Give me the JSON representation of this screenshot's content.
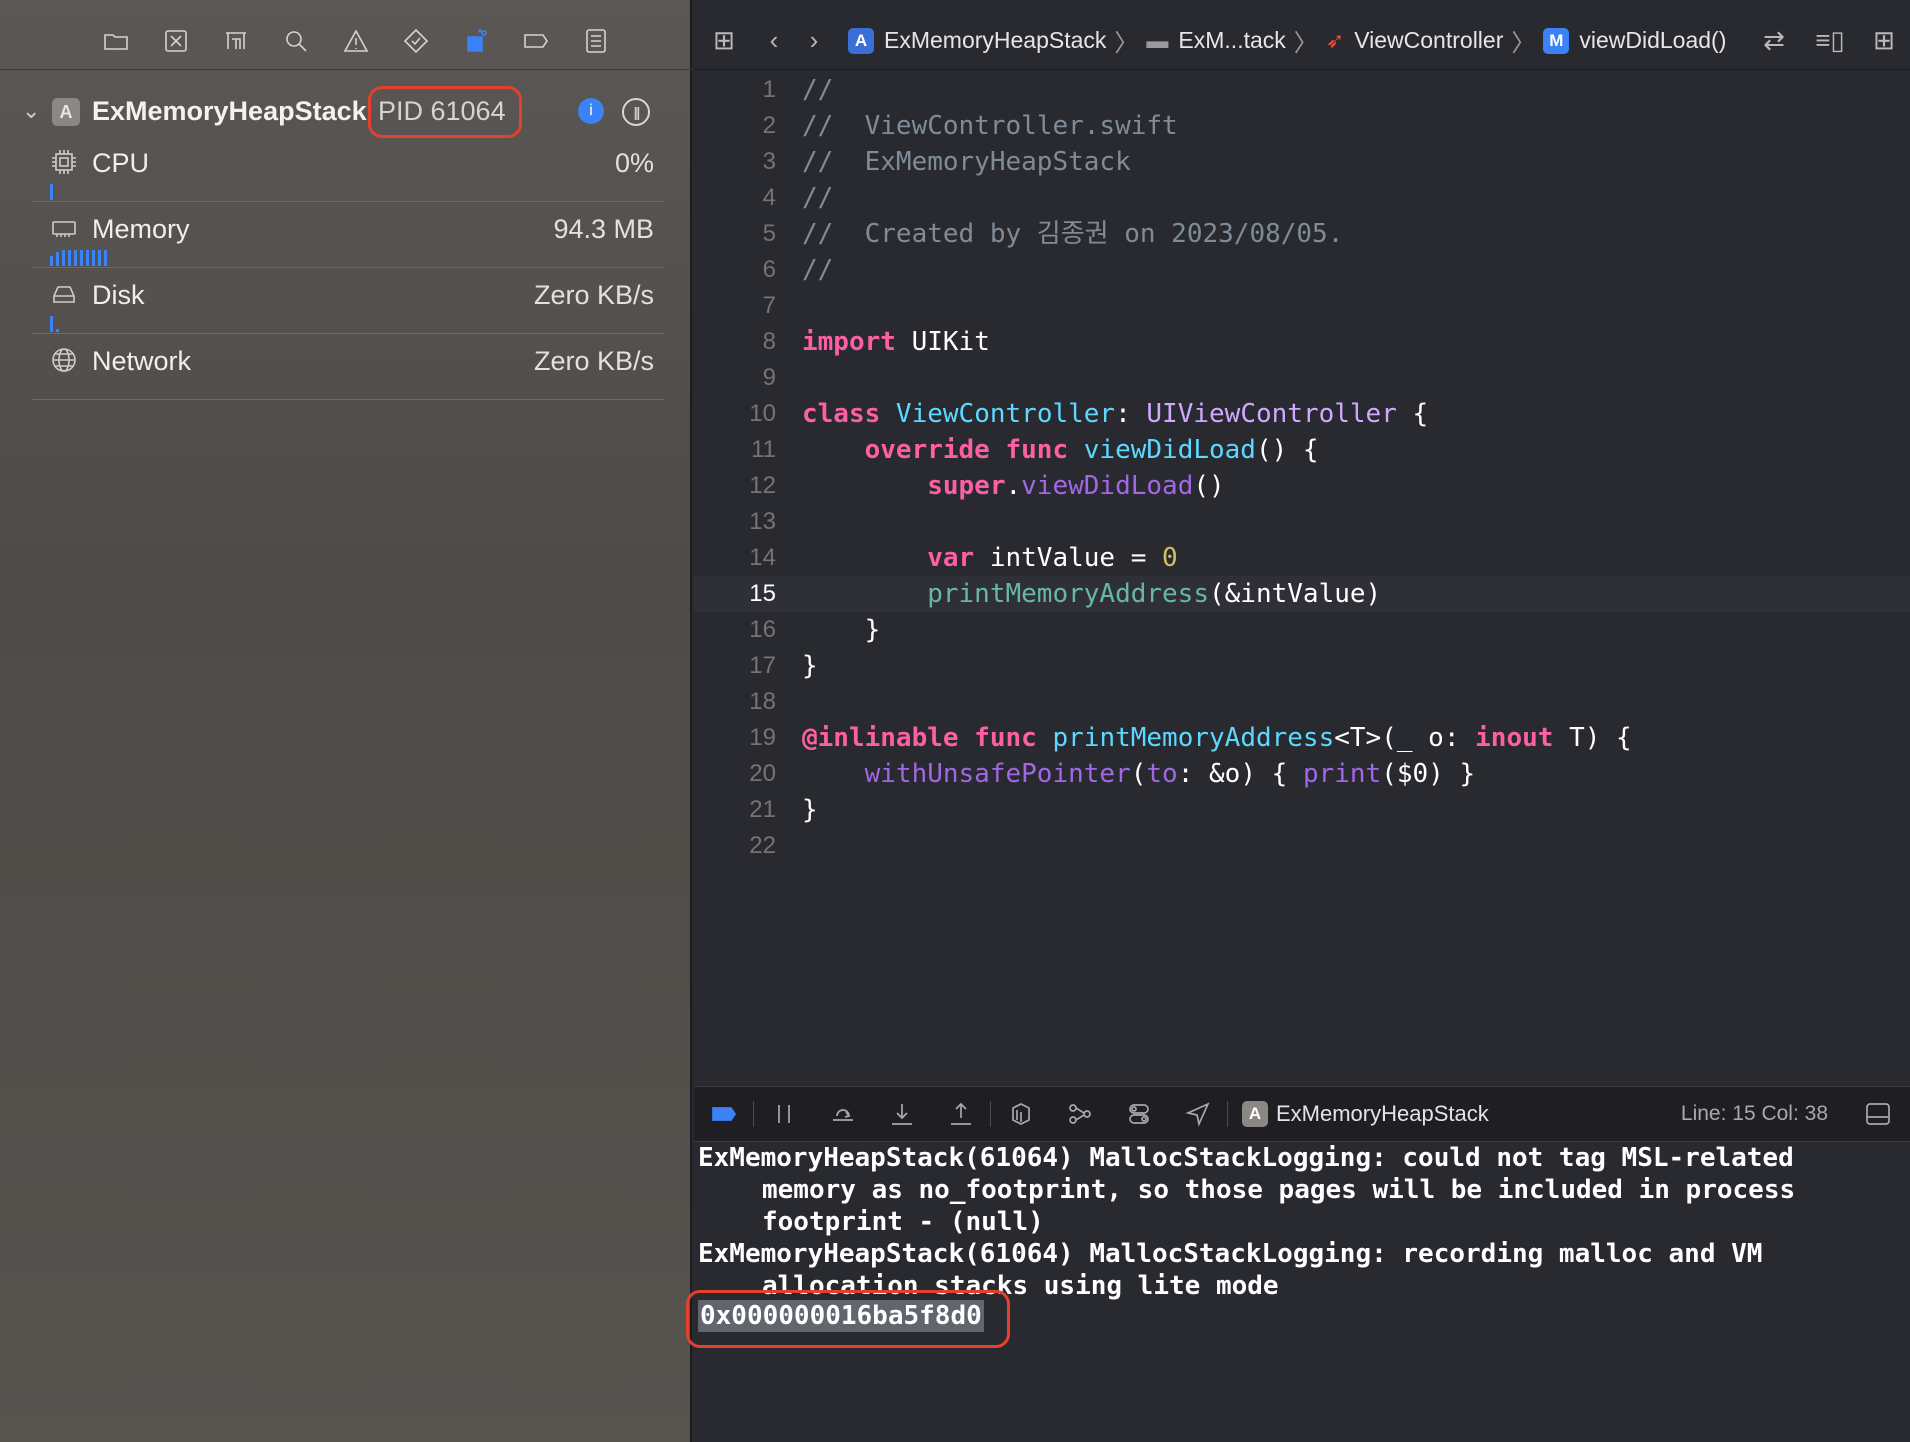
{
  "navigator": {
    "process": {
      "name": "ExMemoryHeapStack",
      "pid": "PID 61064"
    },
    "gauges": [
      {
        "label": "CPU",
        "value": "0%"
      },
      {
        "label": "Memory",
        "value": "94.3 MB"
      },
      {
        "label": "Disk",
        "value": "Zero KB/s"
      },
      {
        "label": "Network",
        "value": "Zero KB/s"
      }
    ]
  },
  "jump_bar": {
    "project": "ExMemoryHeapStack",
    "folder": "ExM...tack",
    "file": "ViewController",
    "method_badge": "M",
    "method": "viewDidLoad()"
  },
  "code": {
    "current_line": 15,
    "lines": [
      "1",
      "2",
      "3",
      "4",
      "5",
      "6",
      "7",
      "8",
      "9",
      "10",
      "11",
      "12",
      "13",
      "14",
      "15",
      "16",
      "17",
      "18",
      "19",
      "20",
      "21",
      "22"
    ],
    "tokens": {
      "l1": "//",
      "l2": "//  ViewController.swift",
      "l3": "//  ExMemoryHeapStack",
      "l4": "//",
      "l5": "//  Created by 김종권 on 2023/08/05.",
      "l6": "//",
      "import_kw": "import",
      "import_mod": " UIKit",
      "class_kw": "class",
      "class_name": " ViewController",
      "colon": ": ",
      "super_type": "UIViewController",
      "brace_open": " {",
      "override_kw": "    override",
      "func_kw": " func",
      "vdl_name": " viewDidLoad",
      "paren_brace": "() {",
      "super_kw": "        super",
      "dot": ".",
      "super_vdl": "viewDidLoad",
      "parens": "()",
      "var_kw": "        var",
      "var_name": " intValue = ",
      "zero": "0",
      "pma_call": "        printMemoryAddress",
      "pma_args": "(&intValue)",
      "close_inner": "    }",
      "close_outer": "}",
      "inlinable": "@inlinable",
      "func_kw2": " func",
      "pma_decl": " printMemoryAddress",
      "generic": "<T>(",
      "underscore": "_ o: ",
      "inout_kw": "inout",
      "t_close": " T) {",
      "wup": "    withUnsafePointer",
      "wup_open": "(",
      "to_label": "to",
      "wup_mid": ": &o) { ",
      "print_fn": "print",
      "print_args": "($0) }",
      "close_func": "}"
    }
  },
  "debug_bar": {
    "process_label": "ExMemoryHeapStack",
    "line_col": "Line: 15  Col: 38"
  },
  "console": {
    "line1": "ExMemoryHeapStack(61064) MallocStackLogging: could not tag MSL-related",
    "line2": "memory as no_footprint, so those pages will be included in process",
    "line3": "footprint - (null)",
    "line4": "ExMemoryHeapStack(61064) MallocStackLogging: recording malloc and VM",
    "line5": "allocation stacks using lite mode",
    "address": "0x000000016ba5f8d0"
  },
  "colors": {
    "highlight_annotation": "#e5402e",
    "accent": "#3b82f6"
  }
}
